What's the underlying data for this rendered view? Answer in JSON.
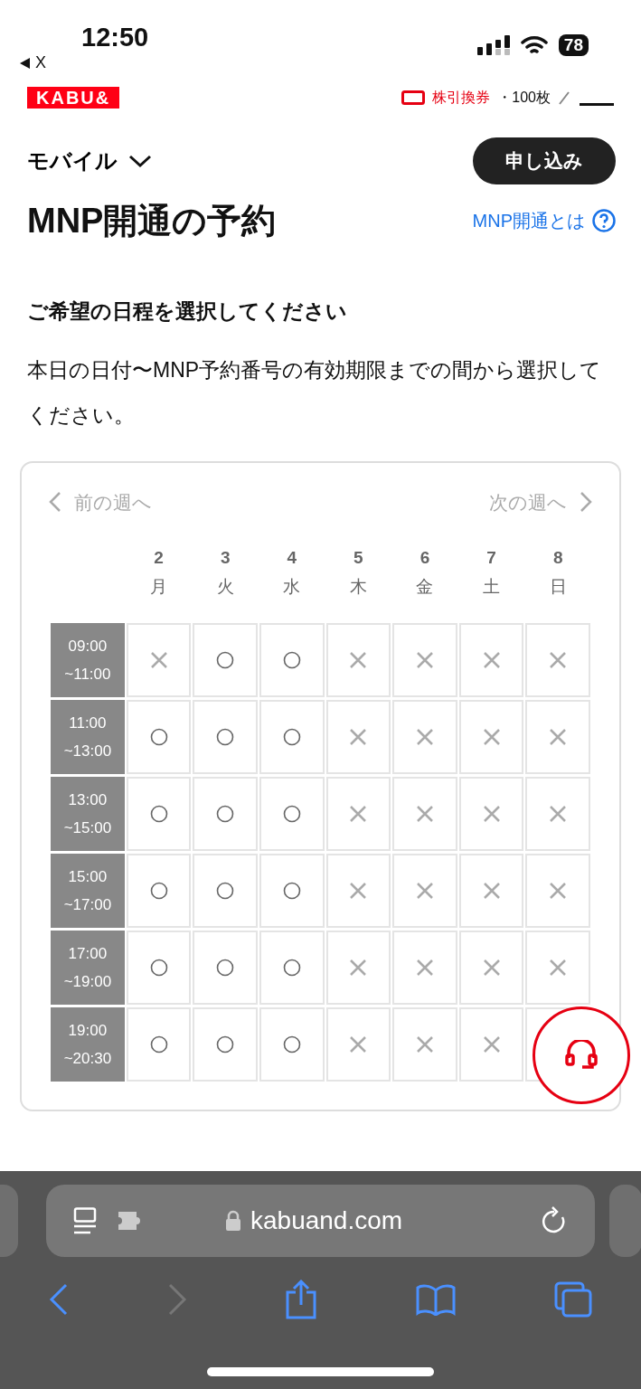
{
  "status_bar": {
    "time": "12:50",
    "back_label": "X",
    "battery": "78"
  },
  "site_header": {
    "logo": "KABU&",
    "ticket_text": "株引換券",
    "ticket_count": "・100枚"
  },
  "nav": {
    "menu_label": "モバイル",
    "apply_button": "申し込み"
  },
  "page": {
    "title": "MNP開通の予約",
    "help_link": "MNP開通とは",
    "subtitle": "ご希望の日程を選択してください",
    "description": "本日の日付〜MNP予約番号の有効期限までの間から選択してください。"
  },
  "calendar": {
    "prev_week": "前の週へ",
    "next_week": "次の週へ",
    "days": [
      {
        "date": "2",
        "weekday": "月"
      },
      {
        "date": "3",
        "weekday": "火"
      },
      {
        "date": "4",
        "weekday": "水"
      },
      {
        "date": "5",
        "weekday": "木"
      },
      {
        "date": "6",
        "weekday": "金"
      },
      {
        "date": "7",
        "weekday": "土"
      },
      {
        "date": "8",
        "weekday": "日"
      }
    ],
    "slots": [
      {
        "start": "09:00",
        "end": "~11:00",
        "cells": [
          {
            "available": false
          },
          {
            "available": true
          },
          {
            "available": true
          },
          {
            "available": false
          },
          {
            "available": false
          },
          {
            "available": false
          },
          {
            "available": false
          }
        ]
      },
      {
        "start": "11:00",
        "end": "~13:00",
        "cells": [
          {
            "available": true
          },
          {
            "available": true
          },
          {
            "available": true
          },
          {
            "available": false
          },
          {
            "available": false
          },
          {
            "available": false
          },
          {
            "available": false
          }
        ]
      },
      {
        "start": "13:00",
        "end": "~15:00",
        "cells": [
          {
            "available": true
          },
          {
            "available": true
          },
          {
            "available": true
          },
          {
            "available": false
          },
          {
            "available": false
          },
          {
            "available": false
          },
          {
            "available": false
          }
        ]
      },
      {
        "start": "15:00",
        "end": "~17:00",
        "cells": [
          {
            "available": true
          },
          {
            "available": true
          },
          {
            "available": true
          },
          {
            "available": false
          },
          {
            "available": false
          },
          {
            "available": false
          },
          {
            "available": false
          }
        ]
      },
      {
        "start": "17:00",
        "end": "~19:00",
        "cells": [
          {
            "available": true
          },
          {
            "available": true
          },
          {
            "available": true
          },
          {
            "available": false
          },
          {
            "available": false
          },
          {
            "available": false
          },
          {
            "available": false
          }
        ]
      },
      {
        "start": "19:00",
        "end": "~20:30",
        "cells": [
          {
            "available": true
          },
          {
            "available": true
          },
          {
            "available": true
          },
          {
            "available": false
          },
          {
            "available": false
          },
          {
            "available": false
          }
        ]
      }
    ]
  },
  "browser": {
    "url": "kabuand.com"
  }
}
